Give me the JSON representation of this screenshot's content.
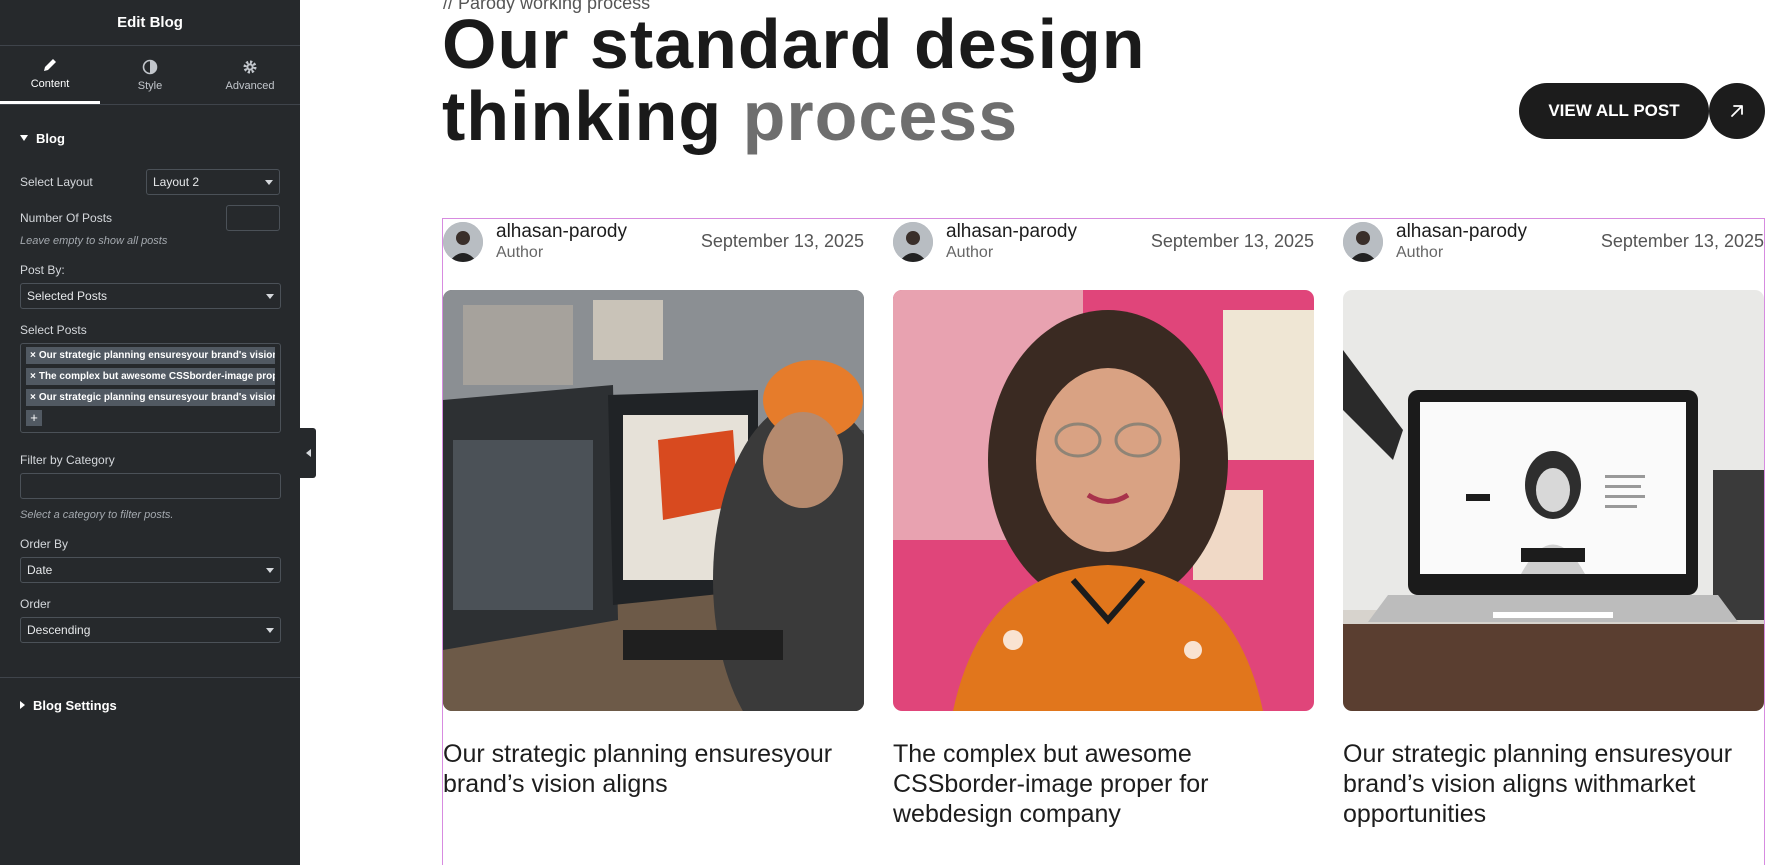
{
  "panel": {
    "title": "Edit Blog",
    "tabs": [
      {
        "label": "Content",
        "icon": "pencil-icon"
      },
      {
        "label": "Style",
        "icon": "contrast-icon"
      },
      {
        "label": "Advanced",
        "icon": "gear-icon"
      }
    ],
    "section_blog": "Blog",
    "select_layout_label": "Select Layout",
    "select_layout_value": "Layout 2",
    "number_of_posts_label": "Number Of Posts",
    "number_of_posts_hint": "Leave empty to show all posts",
    "post_by_label": "Post By:",
    "post_by_value": "Selected Posts",
    "select_posts_label": "Select Posts",
    "selected_posts": [
      "Our strategic planning ensuresyour brand's vision aligns",
      "The complex but awesome CSSborder-image proper for webdesign company",
      "Our strategic planning ensuresyour brand's vision aligns withmarket opportunities"
    ],
    "tag_remove": "×",
    "tag_add": "+",
    "filter_category_label": "Filter by Category",
    "filter_category_hint": "Select a category to filter posts.",
    "order_by_label": "Order By",
    "order_by_value": "Date",
    "order_label": "Order",
    "order_value": "Descending",
    "section_blog_settings": "Blog Settings"
  },
  "preview": {
    "eyebrow": "// Parody working process",
    "headline_line1": "Our standard design",
    "headline_line2_dark": "thinking",
    "headline_line2_light": "process",
    "view_all_label": "VIEW ALL POST",
    "arrow_icon": "arrow-up-right-icon",
    "posts": [
      {
        "author": "alhasan-parody",
        "role": "Author",
        "date": "September 13, 2025",
        "title": "Our strategic planning ensuresyour brand’s vision aligns"
      },
      {
        "author": "alhasan-parody",
        "role": "Author",
        "date": "September 13, 2025",
        "title": "The complex but awesome CSSborder-image proper for webdesign company"
      },
      {
        "author": "alhasan-parody",
        "role": "Author",
        "date": "September 13, 2025",
        "title": "Our strategic planning ensuresyour brand’s vision aligns withmarket opportunities"
      }
    ]
  },
  "colors": {
    "panel_bg": "#26292c",
    "button_dark": "#1c1c1c",
    "selection_outline": "#d78be0"
  }
}
